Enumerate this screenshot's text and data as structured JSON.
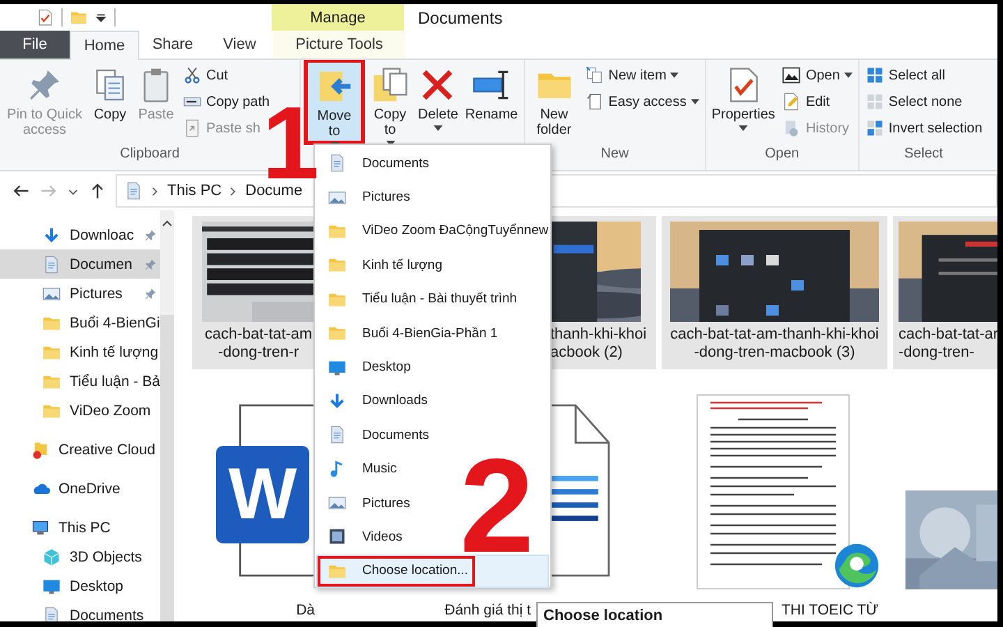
{
  "window": {
    "title": "Documents"
  },
  "context_tab": {
    "label": "Manage"
  },
  "tabs": [
    {
      "label": "File",
      "kind": "file",
      "selected": false
    },
    {
      "label": "Home",
      "kind": "tab",
      "selected": true
    },
    {
      "label": "Share",
      "kind": "tab",
      "selected": false
    },
    {
      "label": "View",
      "kind": "tab",
      "selected": false
    },
    {
      "label": "Picture Tools",
      "kind": "context",
      "selected": false
    }
  ],
  "ribbon": {
    "groups": [
      {
        "label": "Clipboard",
        "large": [
          {
            "label": "Pin to Quick access",
            "kind": "pin",
            "dropdown": false,
            "disabled": true,
            "selected": false,
            "outlined": false
          },
          {
            "label": "Copy",
            "kind": "copy",
            "dropdown": false,
            "disabled": false,
            "selected": false,
            "outlined": false
          },
          {
            "label": "Paste",
            "kind": "paste",
            "dropdown": false,
            "disabled": true,
            "selected": false,
            "outlined": false
          }
        ],
        "small": [
          {
            "label": "Cut",
            "kind": "cut",
            "dropdown": false,
            "disabled": false
          },
          {
            "label": "Copy path",
            "kind": "path",
            "dropdown": false,
            "disabled": false
          },
          {
            "label": "Paste sh",
            "kind": "shortcut",
            "dropdown": false,
            "disabled": true
          }
        ]
      },
      {
        "large": [
          {
            "label": "Move to",
            "kind": "moveto",
            "dropdown": true,
            "disabled": false,
            "selected": true,
            "outlined": true
          },
          {
            "label": "Copy to",
            "kind": "copyto",
            "dropdown": true,
            "disabled": false,
            "selected": false,
            "outlined": false
          },
          {
            "label": "Delete",
            "kind": "delete",
            "dropdown": true,
            "disabled": false,
            "selected": false,
            "outlined": false
          },
          {
            "label": "Rename",
            "kind": "rename",
            "dropdown": false,
            "disabled": false,
            "selected": false,
            "outlined": false
          }
        ]
      },
      {
        "label": "New",
        "large": [
          {
            "label": "New folder",
            "kind": "folder",
            "dropdown": false,
            "disabled": false,
            "selected": false,
            "outlined": false
          }
        ],
        "small": [
          {
            "label": "New item",
            "kind": "newitem",
            "dropdown": true,
            "disabled": false
          },
          {
            "label": "Easy access",
            "kind": "easyaccess",
            "dropdown": true,
            "disabled": false
          }
        ]
      },
      {
        "label": "Open",
        "large": [
          {
            "label": "Properties",
            "kind": "properties",
            "dropdown": true,
            "disabled": false,
            "selected": false,
            "outlined": false
          }
        ],
        "small": [
          {
            "label": "Open",
            "kind": "open",
            "dropdown": true,
            "disabled": false
          },
          {
            "label": "Edit",
            "kind": "edit",
            "dropdown": false,
            "disabled": false
          },
          {
            "label": "History",
            "kind": "history",
            "dropdown": false,
            "disabled": true
          }
        ]
      },
      {
        "label": "Select",
        "small": [
          {
            "label": "Select all",
            "kind": "selectall",
            "dropdown": false,
            "disabled": false
          },
          {
            "label": "Select none",
            "kind": "selectnone",
            "dropdown": false,
            "disabled": false
          },
          {
            "label": "Invert selection",
            "kind": "invert",
            "dropdown": false,
            "disabled": false
          }
        ]
      }
    ]
  },
  "address": {
    "path": [
      "This PC",
      "Docume"
    ]
  },
  "sidebar": {
    "quick_access": [
      {
        "label": "Downloac",
        "kind": "downloads",
        "pinned": true,
        "selected": false
      },
      {
        "label": "Documen",
        "kind": "documents",
        "pinned": true,
        "selected": true
      },
      {
        "label": "Pictures",
        "kind": "pictures",
        "pinned": true,
        "selected": false
      },
      {
        "label": "Buổi 4-BienGi",
        "kind": "folder",
        "pinned": false,
        "selected": false
      },
      {
        "label": "Kinh tế lượng",
        "kind": "folder",
        "pinned": false,
        "selected": false
      },
      {
        "label": "Tiểu luận - Bả",
        "kind": "folder",
        "pinned": false,
        "selected": false
      },
      {
        "label": "ViDeo Zoom",
        "kind": "folder",
        "pinned": false,
        "selected": false
      }
    ],
    "locations": [
      {
        "label": "Creative Cloud",
        "kind": "cloud",
        "selected": false
      },
      {
        "label": "OneDrive",
        "kind": "onedrive",
        "selected": false
      },
      {
        "label": "This PC",
        "kind": "pc",
        "selected": false,
        "children": [
          {
            "label": "3D Objects",
            "kind": "objects3d",
            "selected": false
          },
          {
            "label": "Desktop",
            "kind": "desktop",
            "selected": false
          },
          {
            "label": "Documents",
            "kind": "documents",
            "selected": false
          }
        ]
      }
    ]
  },
  "files": {
    "rows": [
      {
        "items": [
          {
            "kind": "picture",
            "selected": true,
            "name_lines": [
              "cach-bat-tat-am",
              "-dong-tren-r"
            ]
          },
          {
            "kind": "picture",
            "selected": true,
            "name_lines": [
              "thanh-khi-khoi",
              "acbook (2)"
            ]
          },
          {
            "kind": "picture",
            "selected": true,
            "name_lines": [
              "cach-bat-tat-am-thanh-khi-khoi",
              "-dong-tren-macbook (3)"
            ]
          },
          {
            "kind": "picture",
            "selected": true,
            "name_lines": [
              "cach-bat-tat-ar",
              "-dong-tren-"
            ]
          }
        ]
      },
      {
        "items": [
          {
            "kind": "word",
            "badge": "W",
            "selected": false,
            "name_lines": [
              "Dà"
            ]
          },
          {
            "kind": "document",
            "selected": false,
            "name_lines": [
              "Đánh giá thị t"
            ]
          },
          {
            "kind": "pdf",
            "selected": false,
            "name_lines": [
              "THI TOEIC TỪ"
            ]
          },
          {
            "kind": "picture",
            "selected": false
          }
        ]
      }
    ]
  },
  "move_to_menu": {
    "items": [
      {
        "label": "Documents",
        "kind": "documents",
        "highlighted": false,
        "outlined": false
      },
      {
        "label": "Pictures",
        "kind": "pictures",
        "highlighted": false,
        "outlined": false
      },
      {
        "label": "ViDeo Zoom ĐaCộngTuyểnnew",
        "kind": "folder",
        "highlighted": false,
        "outlined": false
      },
      {
        "label": "Kinh tế lượng",
        "kind": "folder",
        "highlighted": false,
        "outlined": false
      },
      {
        "label": "Tiểu luận - Bài thuyết trình",
        "kind": "folder",
        "highlighted": false,
        "outlined": false
      },
      {
        "label": "Buổi 4-BienGia-Phần 1",
        "kind": "folder",
        "highlighted": false,
        "outlined": false
      },
      {
        "label": "Desktop",
        "kind": "desktop",
        "highlighted": false,
        "outlined": false
      },
      {
        "label": "Downloads",
        "kind": "downloads",
        "highlighted": false,
        "outlined": false
      },
      {
        "label": "Documents",
        "kind": "documents",
        "highlighted": false,
        "outlined": false
      },
      {
        "label": "Music",
        "kind": "music",
        "highlighted": false,
        "outlined": false
      },
      {
        "label": "Pictures",
        "kind": "pictures",
        "highlighted": false,
        "outlined": false
      },
      {
        "label": "Videos",
        "kind": "videos",
        "highlighted": false,
        "outlined": false
      },
      {
        "label": "Choose location...",
        "kind": "folder",
        "highlighted": true,
        "outlined": true
      }
    ]
  },
  "tooltip": {
    "text": "Choose location"
  },
  "annotations": [
    {
      "label": "1"
    },
    {
      "label": "2"
    }
  ]
}
